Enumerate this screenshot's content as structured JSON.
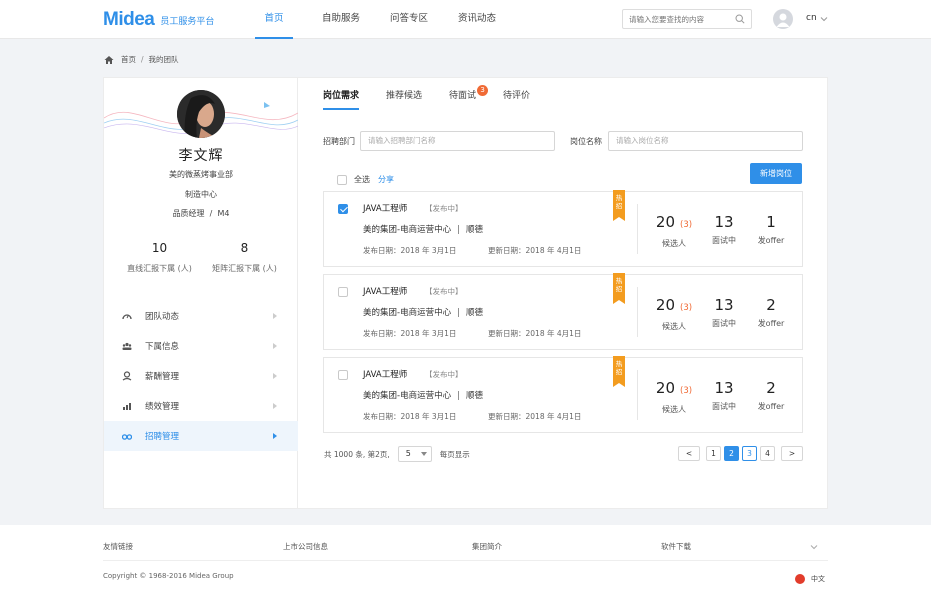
{
  "brand": {
    "logo": "Midea",
    "subtitle": "员工服务平台"
  },
  "nav": [
    {
      "label": "首页",
      "active": true
    },
    {
      "label": "自助服务",
      "active": false
    },
    {
      "label": "问答专区",
      "active": false
    },
    {
      "label": "资讯动态",
      "active": false
    }
  ],
  "search": {
    "placeholder": "请输入您要查找的内容"
  },
  "user_lang": "cn",
  "breadcrumb": {
    "home": "首页",
    "current": "我的团队"
  },
  "profile": {
    "name": "李文辉",
    "dept": "美的微蒸烤事业部",
    "center": "制造中心",
    "role": "品质经理",
    "level": "M4",
    "stats": [
      {
        "value": "10",
        "label": "直线汇报下属 (人)"
      },
      {
        "value": "8",
        "label": "矩阵汇报下属 (人)"
      }
    ]
  },
  "menu": [
    {
      "label": "团队动态",
      "icon": "speedometer-icon",
      "active": false
    },
    {
      "label": "下属信息",
      "icon": "team-icon",
      "active": false
    },
    {
      "label": "薪酬管理",
      "icon": "salary-icon",
      "active": false
    },
    {
      "label": "绩效管理",
      "icon": "chart-icon",
      "active": false
    },
    {
      "label": "招聘管理",
      "icon": "binoculars-icon",
      "active": true
    }
  ],
  "tabs": [
    {
      "label": "岗位需求",
      "active": true
    },
    {
      "label": "推荐候选",
      "active": false
    },
    {
      "label": "待面试",
      "active": false,
      "badge": "3"
    },
    {
      "label": "待评价",
      "active": false
    }
  ],
  "filters": {
    "dept_label": "招聘部门",
    "dept_placeholder": "请输入招聘部门名称",
    "post_label": "岗位名称",
    "post_placeholder": "请输入岗位名称"
  },
  "select_all": "全选",
  "share": "分享",
  "new_button": "新增岗位",
  "jobs": [
    {
      "checked": true,
      "title": "JAVA工程师",
      "status": "【发布中】",
      "org": "美的集团-电商运营中心",
      "location": "顺德",
      "publish": "发布日期：2018 年 3月1日",
      "update": "更新日期：2018 年 4月1日",
      "hot": "热招",
      "candidates": "20",
      "candidates_new": "(3)",
      "candidates_label": "候选人",
      "interviews": "13",
      "interviews_label": "面试中",
      "offers": "1",
      "offers_label": "发offer"
    },
    {
      "checked": false,
      "title": "JAVA工程师",
      "status": "【发布中】",
      "org": "美的集团-电商运营中心",
      "location": "顺德",
      "publish": "发布日期：2018 年 3月1日",
      "update": "更新日期：2018 年 4月1日",
      "hot": "热招",
      "candidates": "20",
      "candidates_new": "(3)",
      "candidates_label": "候选人",
      "interviews": "13",
      "interviews_label": "面试中",
      "offers": "2",
      "offers_label": "发offer"
    },
    {
      "checked": false,
      "title": "JAVA工程师",
      "status": "【发布中】",
      "org": "美的集团-电商运营中心",
      "location": "顺德",
      "publish": "发布日期：2018 年 3月1日",
      "update": "更新日期：2018 年 4月1日",
      "hot": "热招",
      "candidates": "20",
      "candidates_new": "(3)",
      "candidates_label": "候选人",
      "interviews": "13",
      "interviews_label": "面试中",
      "offers": "2",
      "offers_label": "发offer"
    }
  ],
  "pagination": {
    "summary": "共 1000 条, 第2页,",
    "page_size": "5",
    "per_page_label": "每页显示",
    "prev": "<",
    "pages": [
      "1",
      "2",
      "3",
      "4"
    ],
    "current": "2",
    "next": ">"
  },
  "colors": {
    "primary": "#2f8fe8",
    "accent": "#f06a35",
    "hot": "#f39c1f"
  },
  "footer": {
    "links": [
      "友情链接",
      "上市公司信息",
      "集团简介",
      "软件下载"
    ],
    "copyright": "Copyright © 1968-2016 Midea Group",
    "lang": "中文"
  }
}
